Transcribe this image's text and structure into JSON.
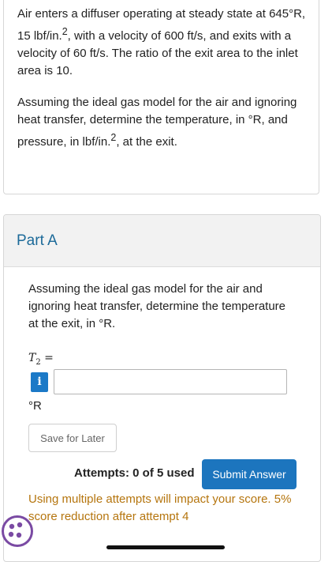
{
  "problem": {
    "paragraph1_a": "Air enters a diffuser operating at steady state at 645°R, 15 lbf/in.",
    "paragraph1_sup": "2",
    "paragraph1_b": ", with a velocity of 600 ft/s, and exits with a velocity of 60 ft/s. The ratio of the exit area to the inlet area is 10.",
    "paragraph2_a": "Assuming the ideal gas model for the air and ignoring heat transfer, determine the temperature, in °R, and pressure, in lbf/in.",
    "paragraph2_sup": "2",
    "paragraph2_b": ", at the exit."
  },
  "part": {
    "title": "Part A",
    "question": "Assuming the ideal gas model for the air and ignoring heat transfer, determine the temperature at the exit, in °R.",
    "variable_symbol": "T",
    "variable_subscript": "2",
    "variable_equals": " =",
    "info_glyph": "i",
    "input_value": "",
    "unit": "°R",
    "save_label": "Save for Later",
    "attempts_text": "Attempts: 0 of 5 used",
    "submit_label": "Submit Answer",
    "warning_text": "Using multiple attempts will impact your score. 5% score reduction after attempt 4"
  },
  "colors": {
    "part_title": "#1c6a99",
    "submit_bg": "#1c75be",
    "info_badge": "#1b79c7",
    "warning": "#b5750e",
    "help_bubble": "#7a4aa3"
  },
  "icons": {
    "info": "info-icon",
    "help": "help-bubble-icon"
  }
}
